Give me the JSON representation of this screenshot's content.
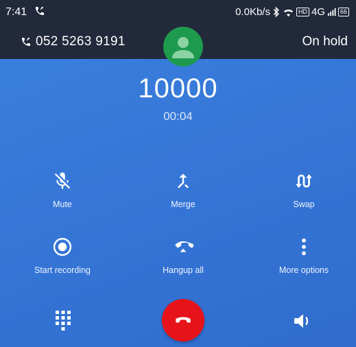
{
  "status_bar": {
    "time": "7:41",
    "network_speed": "0.0Kb/s",
    "network_type": "4G",
    "hd_badge": "HD",
    "battery": "66"
  },
  "hold_bar": {
    "number": "052 5263 9191",
    "status": "On hold"
  },
  "caller": {
    "name": "10000",
    "timer": "00:04"
  },
  "controls": {
    "mute": "Mute",
    "merge": "Merge",
    "swap": "Swap",
    "start_recording": "Start recording",
    "hangup_all": "Hangup all",
    "more_options": "More options"
  },
  "icons": {
    "mute": "mic-off-icon",
    "merge": "merge-icon",
    "swap": "swap-icon",
    "record": "record-icon",
    "hangup_all": "hangup-all-icon",
    "more": "more-vertical-icon",
    "dialpad": "dialpad-icon",
    "hangup": "hangup-icon",
    "speaker": "speaker-icon"
  },
  "colors": {
    "background": "#3677d8",
    "top_bar": "#22293a",
    "avatar": "#1e9a4f",
    "hangup": "#e6141a"
  }
}
